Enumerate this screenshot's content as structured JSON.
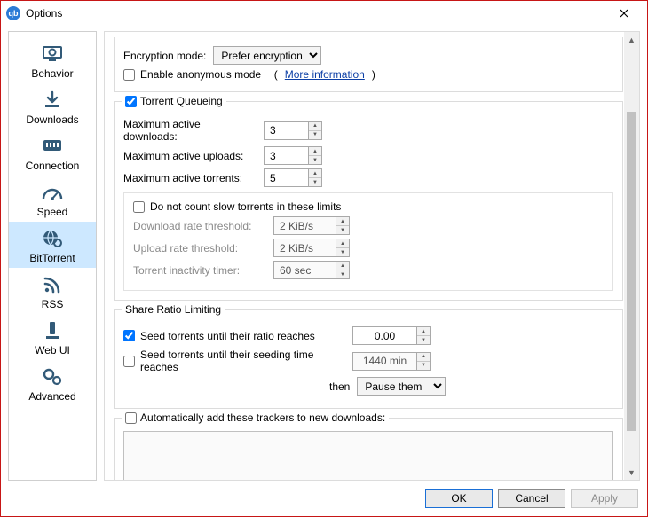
{
  "window": {
    "title": "Options"
  },
  "sidebar": {
    "items": [
      {
        "label": "Behavior"
      },
      {
        "label": "Downloads"
      },
      {
        "label": "Connection"
      },
      {
        "label": "Speed"
      },
      {
        "label": "BitTorrent"
      },
      {
        "label": "RSS"
      },
      {
        "label": "Web UI"
      },
      {
        "label": "Advanced"
      }
    ],
    "selected_index": 4
  },
  "encryption": {
    "label": "Encryption mode:",
    "value": "Prefer encryption",
    "anonymous_label": "Enable anonymous mode",
    "anonymous_checked": false,
    "more_info": "More information"
  },
  "queueing": {
    "legend": "Torrent Queueing",
    "enabled": true,
    "max_downloads_label": "Maximum active downloads:",
    "max_downloads": "3",
    "max_uploads_label": "Maximum active uploads:",
    "max_uploads": "3",
    "max_torrents_label": "Maximum active torrents:",
    "max_torrents": "5",
    "slow": {
      "label": "Do not count slow torrents in these limits",
      "checked": false,
      "dl_label": "Download rate threshold:",
      "dl_value": "2 KiB/s",
      "ul_label": "Upload rate threshold:",
      "ul_value": "2 KiB/s",
      "inactivity_label": "Torrent inactivity timer:",
      "inactivity_value": "60 sec"
    }
  },
  "share": {
    "legend": "Share Ratio Limiting",
    "ratio_label": "Seed torrents until their ratio reaches",
    "ratio_checked": true,
    "ratio_value": "0.00",
    "time_label": "Seed torrents until their seeding time reaches",
    "time_checked": false,
    "time_value": "1440 min",
    "then_label": "then",
    "then_action": "Pause them"
  },
  "trackers": {
    "label": "Automatically add these trackers to new downloads:",
    "checked": false,
    "value": ""
  },
  "footer": {
    "ok": "OK",
    "cancel": "Cancel",
    "apply": "Apply"
  }
}
